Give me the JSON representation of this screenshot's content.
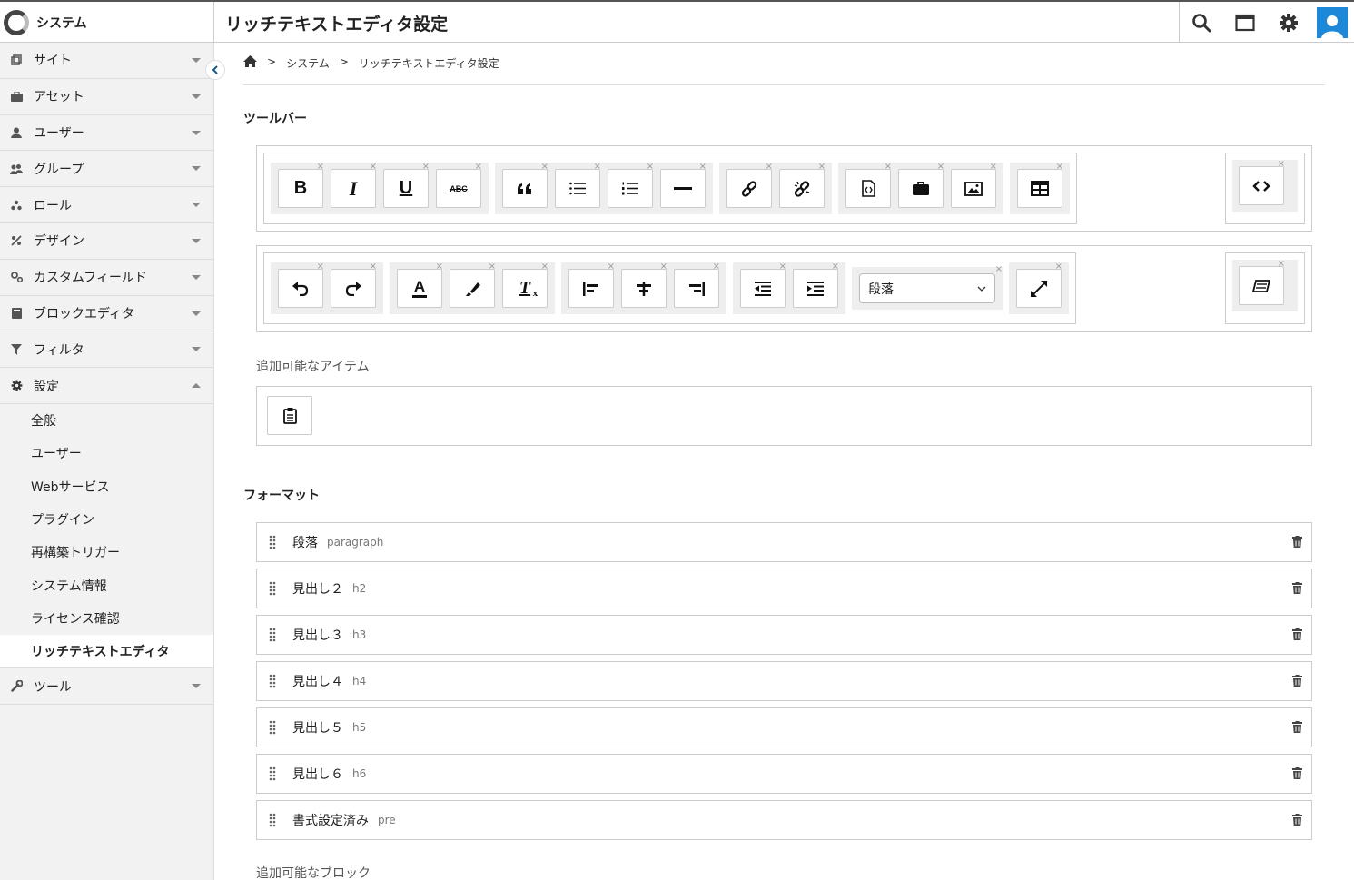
{
  "app": {
    "title": "システム",
    "page_title": "リッチテキストエディタ設定"
  },
  "header_icons": [
    "search-icon",
    "window-icon",
    "gear-icon",
    "user-avatar-icon"
  ],
  "sidebar": {
    "items": [
      {
        "label": "サイト",
        "icon": "site-icon"
      },
      {
        "label": "アセット",
        "icon": "asset-icon"
      },
      {
        "label": "ユーザー",
        "icon": "user-icon"
      },
      {
        "label": "グループ",
        "icon": "group-icon"
      },
      {
        "label": "ロール",
        "icon": "role-icon"
      },
      {
        "label": "デザイン",
        "icon": "design-icon"
      },
      {
        "label": "カスタムフィールド",
        "icon": "custom-field-icon"
      },
      {
        "label": "ブロックエディタ",
        "icon": "block-editor-icon"
      },
      {
        "label": "フィルタ",
        "icon": "filter-icon"
      },
      {
        "label": "設定",
        "icon": "settings-icon"
      },
      {
        "label": "ツール",
        "icon": "tool-icon"
      }
    ],
    "settings_sub": [
      {
        "label": "全般"
      },
      {
        "label": "ユーザー"
      },
      {
        "label": "Webサービス"
      },
      {
        "label": "プラグイン"
      },
      {
        "label": "再構築トリガー"
      },
      {
        "label": "システム情報"
      },
      {
        "label": "ライセンス確認"
      },
      {
        "label": "リッチテキストエディタ"
      }
    ]
  },
  "breadcrumb": {
    "sep": ">",
    "system": "システム",
    "current": "リッチテキストエディタ設定"
  },
  "toolbar": {
    "title": "ツールバー",
    "bold": "B",
    "italic": "I",
    "underline": "U",
    "strike": "ABC",
    "underline_a": "A",
    "clear_format": "T",
    "clear_format_sub": "x",
    "select_value": "段落",
    "remove": "×"
  },
  "available_items": {
    "label": "追加可能なアイテム"
  },
  "formats": {
    "title": "フォーマット",
    "rows": [
      {
        "name": "段落",
        "tag": "paragraph"
      },
      {
        "name": "見出し２",
        "tag": "h2"
      },
      {
        "name": "見出し３",
        "tag": "h3"
      },
      {
        "name": "見出し４",
        "tag": "h4"
      },
      {
        "name": "見出し５",
        "tag": "h5"
      },
      {
        "name": "見出し６",
        "tag": "h6"
      },
      {
        "name": "書式設定済み",
        "tag": "pre"
      }
    ]
  },
  "available_blocks": {
    "label": "追加可能なブロック"
  }
}
